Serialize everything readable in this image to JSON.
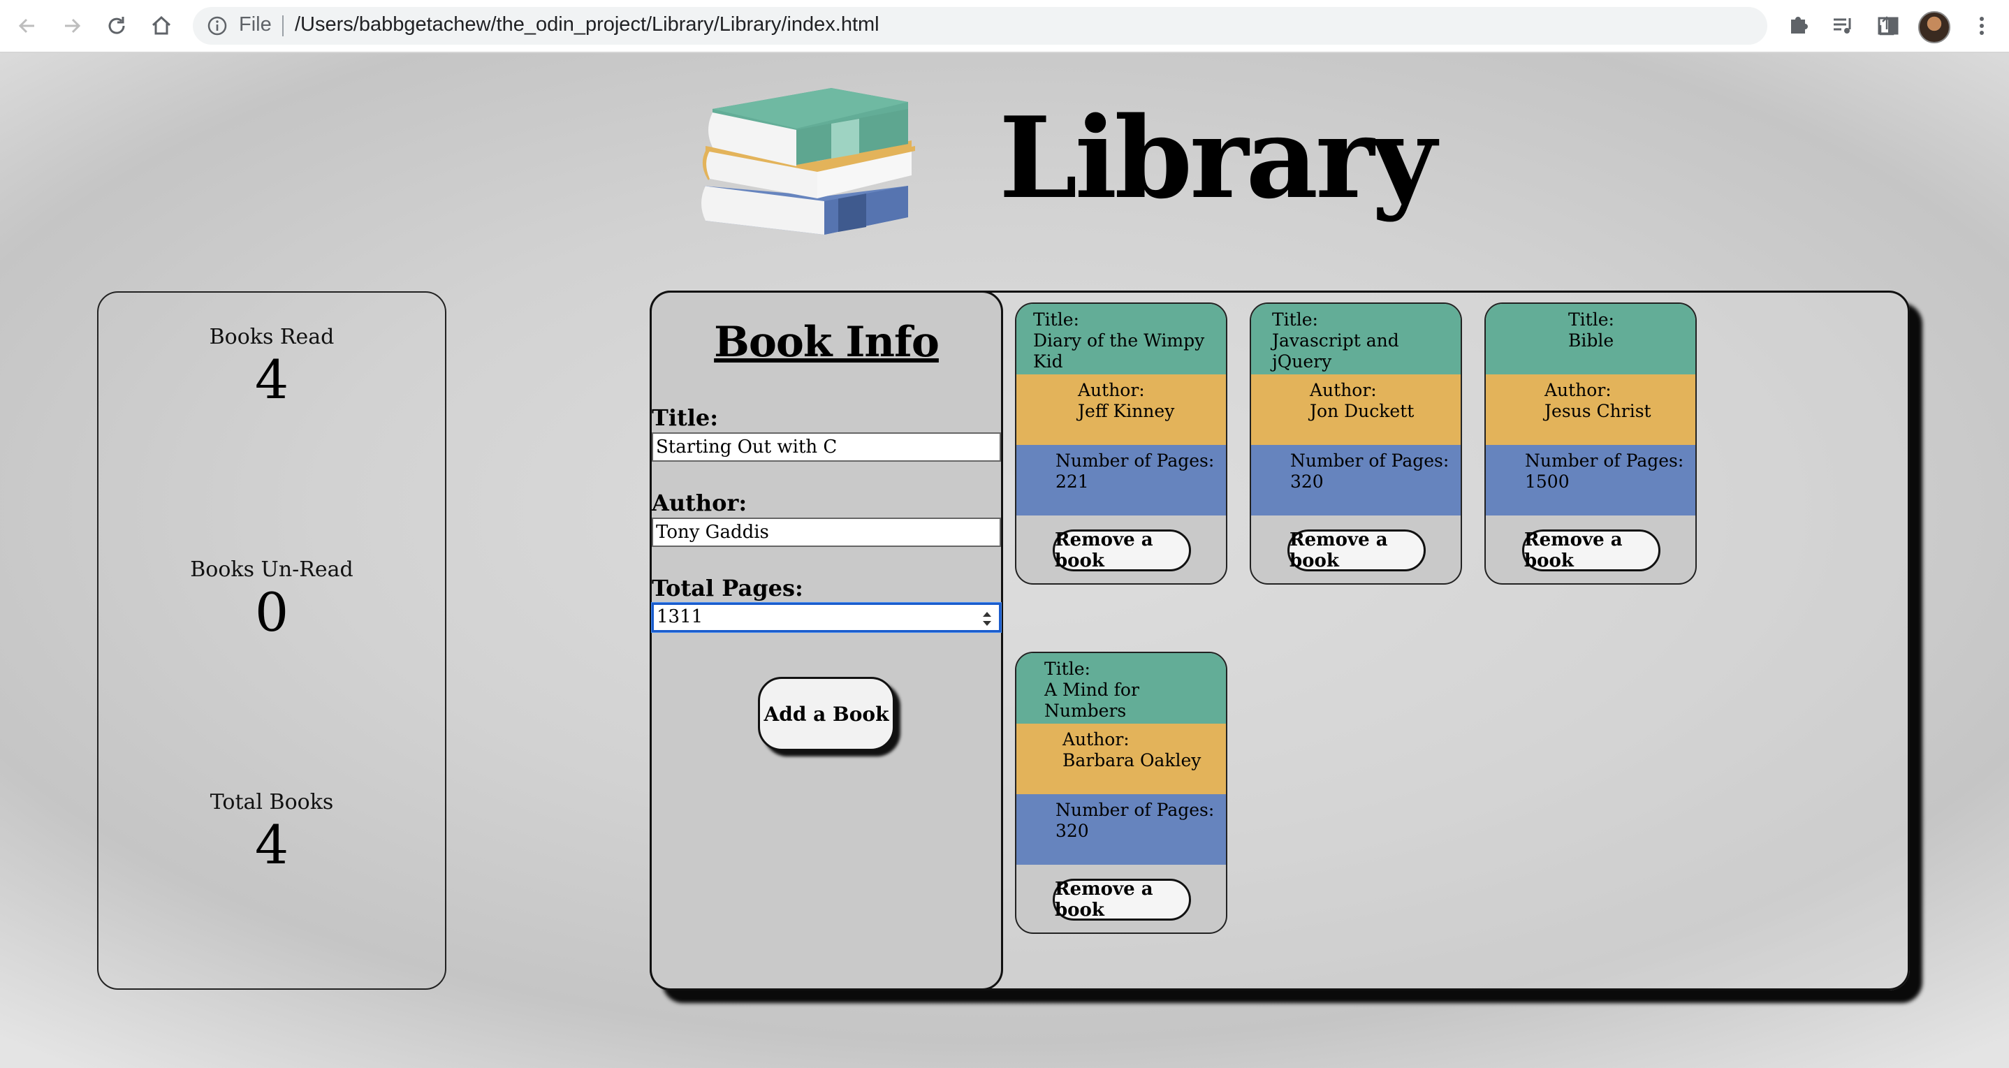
{
  "browser": {
    "file_label": "File",
    "url": "/Users/babbgetachew/the_odin_project/Library/Library/index.html"
  },
  "header": {
    "title": "Library"
  },
  "stats": {
    "read_label": "Books Read",
    "read_value": "4",
    "unread_label": "Books Un-Read",
    "unread_value": "0",
    "total_label": "Total Books",
    "total_value": "4"
  },
  "form": {
    "heading": "Book Info",
    "title_label": "Title:",
    "title_value": "Starting Out with C",
    "author_label": "Author:",
    "author_value": "Tony Gaddis",
    "pages_label": "Total Pages:",
    "pages_value": "1311",
    "submit_label": "Add a Book"
  },
  "books": [
    {
      "title_label": "Title:",
      "title": "Diary of the Wimpy Kid",
      "author_label": "Author:",
      "author": "Jeff Kinney",
      "pages_label": "Number of Pages:",
      "pages": "221",
      "remove_label": "Remove a book"
    },
    {
      "title_label": "Title:",
      "title": "Javascript and jQuery",
      "author_label": "Author:",
      "author": "Jon Duckett",
      "pages_label": "Number of Pages:",
      "pages": "320",
      "remove_label": "Remove a book"
    },
    {
      "title_label": "Title:",
      "title": "Bible",
      "author_label": "Author:",
      "author": "Jesus Christ",
      "pages_label": "Number of Pages:",
      "pages": "1500",
      "remove_label": "Remove a book"
    },
    {
      "title_label": "Title:",
      "title": "A Mind for Numbers",
      "author_label": "Author:",
      "author": "Barbara Oakley",
      "pages_label": "Number of Pages:",
      "pages": "320",
      "remove_label": "Remove a book"
    }
  ],
  "colors": {
    "title_band": "#63ad97",
    "author_band": "#e3b35a",
    "pages_band": "#6684be"
  },
  "icons": [
    "back-icon",
    "forward-icon",
    "reload-icon",
    "home-icon",
    "info-icon",
    "share-icon",
    "star-icon",
    "extensions-icon",
    "media-icon",
    "side-panel-icon",
    "menu-icon"
  ]
}
